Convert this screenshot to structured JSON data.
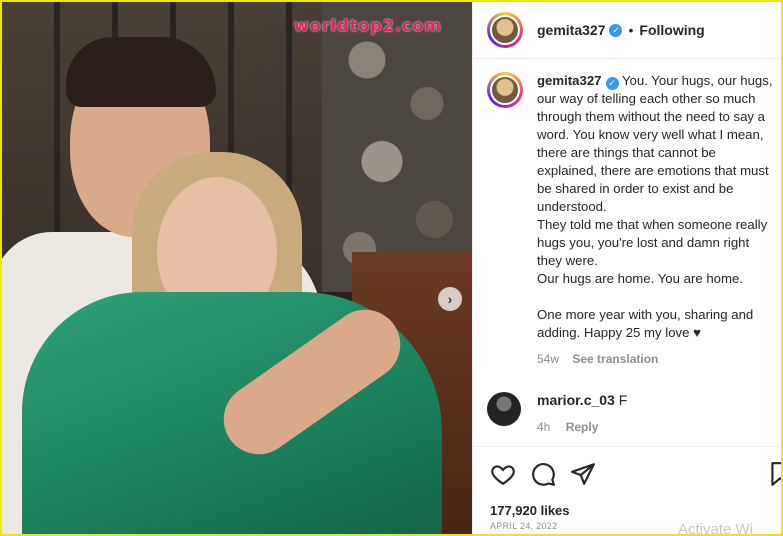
{
  "watermark": "worldtop2.com",
  "post": {
    "username": "gemita327",
    "follow_state": "Following",
    "caption_user": "gemita327",
    "caption_lines": [
      "You. Your hugs, our hugs, our way of telling each other so much through them without the need to say a word. You know very well what I mean, there are things that cannot be explained, there are emotions that must be shared in order to exist and be understood.",
      "They told me that when someone really hugs you, you're lost and damn right they were.",
      "Our hugs are home. You are home.",
      "One more year with you, sharing and adding. Happy 25 my love ♥"
    ],
    "age": "54w",
    "see_translation": "See translation"
  },
  "comment": {
    "username": "marior.c_03",
    "text": "F",
    "age": "4h",
    "reply": "Reply"
  },
  "likes": "177,920 likes",
  "date": "APRIL 24, 2022",
  "overlay_text": "Activate Wi",
  "icons": {
    "like": "heart-icon",
    "comment": "comment-icon",
    "share": "share-icon",
    "save": "bookmark-icon",
    "verified": "verified-badge",
    "next": "chevron-right-icon"
  },
  "colors": {
    "verified": "#3897f0",
    "border": "#f2e600",
    "watermark": "#e0245e"
  }
}
